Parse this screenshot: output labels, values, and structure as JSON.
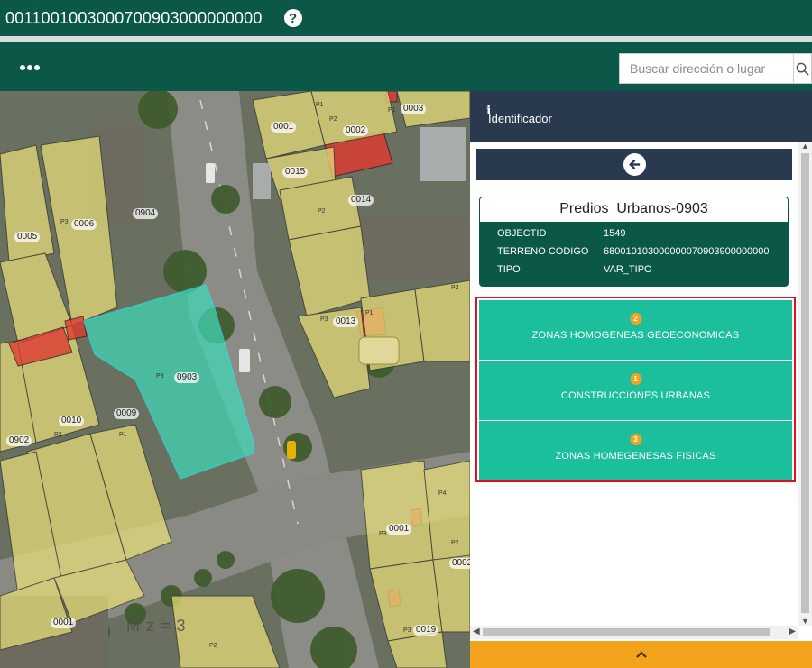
{
  "app": {
    "title": "0011001003000700903000000000",
    "help_icon": "question-circle-icon"
  },
  "toolbar": {
    "menu_icon": "more-dots-icon",
    "search": {
      "placeholder": "Buscar dirección o lugar",
      "icon": "search-icon"
    }
  },
  "map": {
    "parcel_labels": [
      "0003",
      "0001",
      "0002",
      "0015",
      "0014",
      "0904",
      "0006",
      "0005",
      "0013",
      "0903",
      "0009",
      "0010",
      "0902",
      "0001",
      "0002",
      "0019",
      "0001"
    ],
    "part_labels": [
      "P1",
      "P2",
      "P1",
      "P3",
      "P2",
      "P3",
      "P2",
      "P1",
      "P3",
      "P1",
      "P2",
      "P4",
      "P3",
      "P2",
      "P3",
      "P2"
    ],
    "block_label": "M z = 3"
  },
  "panel": {
    "header": {
      "icon": "info-icon",
      "title": "Identificador"
    },
    "back_icon": "arrow-left-icon",
    "feature": {
      "title": "Predios_Urbanos-0903",
      "attributes": [
        {
          "key": "OBJECTID",
          "value": "1549"
        },
        {
          "key": "TERRENO CODIGO",
          "value": "680010103000000070903900000000"
        },
        {
          "key": "TIPO",
          "value": "VAR_TIPO"
        }
      ]
    },
    "related": [
      {
        "count": "2",
        "label": "ZONAS HOMOGENEAS GEOECONOMICAS"
      },
      {
        "count": "1",
        "label": "CONSTRUCCIONES URBANAS"
      },
      {
        "count": "3",
        "label": "ZONAS HOMEGENESAS FISICAS"
      }
    ],
    "footer_icon": "chevron-up-icon"
  },
  "colors": {
    "brand_dark": "#0b5848",
    "panel_dark": "#2a3a4e",
    "teal_button": "#1bbf9c",
    "badge_orange": "#f2a21b",
    "highlight_red": "#e0111b",
    "selected_parcel": "#40d9b8",
    "parcel_yellow": "#e8e07a",
    "parcel_red": "#e03a33"
  }
}
